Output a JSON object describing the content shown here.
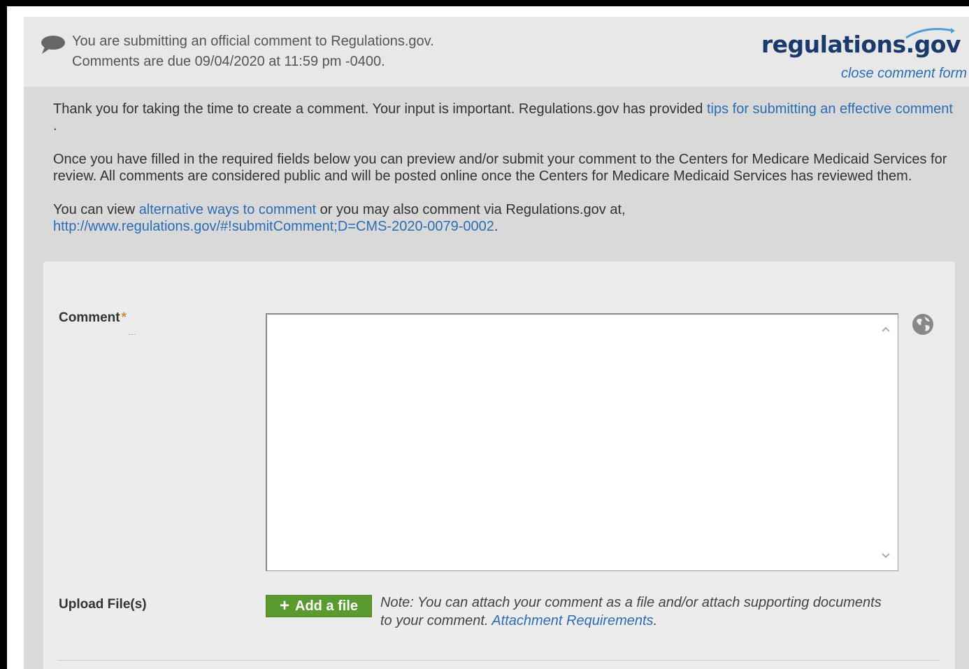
{
  "header": {
    "line1": "You are submitting an official comment to Regulations.gov.",
    "line2": "Comments are due 09/04/2020 at 11:59 pm -0400.",
    "logo_text": "regulations.gov",
    "close_link": "close comment form"
  },
  "intro": {
    "p1_text": "Thank you for taking the time to create a comment. Your input is important. Regulations.gov has provided ",
    "p1_link": "tips for submitting an effective comment",
    "p1_end": " .",
    "p2_text": "Once you have filled in the required fields below you can preview and/or submit your comment to the Centers for Medicare Medicaid Services for review. All comments are considered public and will be posted online once the Centers for Medicare Medicaid Services has reviewed them.",
    "p3_text1": "You can view ",
    "p3_link1": "alternative ways to comment",
    "p3_text2": " or you may also comment via Regulations.gov at, ",
    "p3_link2": "http://www.regulations.gov/#!submitComment;D=CMS-2020-0079-0002",
    "p3_end": "."
  },
  "form": {
    "comment_label": "Comment",
    "required_mark": "*",
    "dots": "....",
    "comment_value": "",
    "upload_label": "Upload File(s)",
    "add_file_plus": "+",
    "add_file_label": "Add a file",
    "note_text": "Note: You can attach your comment as a file and/or attach supporting documents to your comment. ",
    "note_link": "Attachment Requirements",
    "note_end": "."
  },
  "icons": {
    "comment_bubble": "speech-bubble-icon",
    "globe": "globe-icon",
    "scroll_up": "chevron-up-icon",
    "scroll_down": "chevron-down-icon"
  },
  "colors": {
    "link": "#2a6db5",
    "button_green": "#5b9a2e",
    "required_orange": "#d08a3a",
    "logo_navy": "#1a3a6b"
  }
}
